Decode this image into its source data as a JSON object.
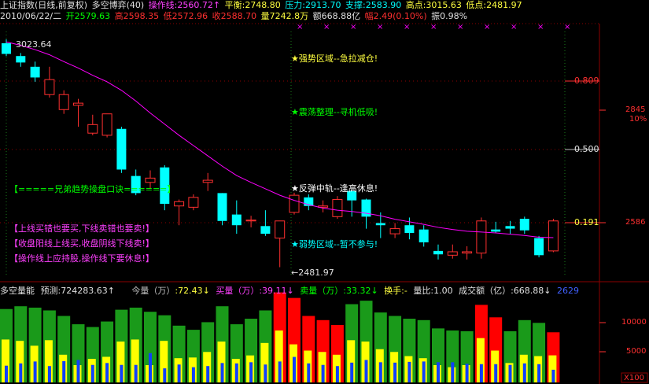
{
  "header": {
    "title": "上证指数(日线,前复权)",
    "indicator": "多空博弈(40)",
    "operation_line": "操作线:2560.72↑",
    "balance": "平衡:2748.80",
    "pressure": "压力:2913.70",
    "support": "支撑:2583.90",
    "high_point": "高点:3015.63",
    "low_point": "低点:2481.97",
    "date": "2010/06/22/二",
    "open": "开2579.63",
    "high": "高2598.35",
    "low": "低2572.96",
    "close": "收2588.70",
    "volume": "量7242.8万",
    "amount": "额668.88亿",
    "change": "幅2.49(0.10%)",
    "amplitude": "振0.98%"
  },
  "price_chart": {
    "peak_label": "3023.64",
    "trough_label": "←2481.97",
    "zones": {
      "strong": "★强势区域--急拉减仓!",
      "shock": "★震荡整理--寻机低吸!",
      "rebound": "★反弹中轨--逢高休息!",
      "weak": "★弱势区域--暂不参与!"
    },
    "tips": [
      "【=====兄弟趋势操盘口诀======】",
      "【上线买错也要买,下线卖错也要卖!】",
      "【收盘阳线上线买,收盘阴线下线卖!】",
      "【操作线上应持股,操作线下要休息!】"
    ],
    "levels": {
      "l0809": "0.809",
      "l0500": "0.500",
      "l0191": "0.191"
    },
    "right_axis": {
      "top": "2845",
      "pct": "10%",
      "bottom": "2586"
    }
  },
  "volume": {
    "title": "多空量能",
    "forecast": "预测:724283.63↑",
    "today_label": "今量（万）",
    "today_value": ":72.43↓",
    "buy_label": "买量（万）",
    "buy_value": ":39.11↓",
    "sell_label": "卖量（万）",
    "sell_value": ":33.32↓",
    "turnover_label": "换手:",
    "turnover_value": "-",
    "ratio": "量比:1.00",
    "amount_label": "成交额（亿）",
    "amount_value": ":668.88↓",
    "extra": "2629",
    "axis": {
      "a10000": "10000",
      "a5000": "5000",
      "unit": "X100"
    }
  },
  "colors": {
    "up": "#ff3030",
    "down": "#00ffff",
    "ma": "#ff00ff",
    "green_vol": "#1a9a1a",
    "yellow_vol": "#ffff00",
    "red_vol": "#ff0000",
    "blue_vol": "#1040ff"
  },
  "chart_data": {
    "type": "candlestick",
    "candles": [
      {
        "o": 3015,
        "c": 2990,
        "h": 3024,
        "l": 2985
      },
      {
        "o": 2985,
        "c": 2970,
        "h": 2992,
        "l": 2960
      },
      {
        "o": 2960,
        "c": 2935,
        "h": 2972,
        "l": 2925
      },
      {
        "o": 2895,
        "c": 2930,
        "h": 2960,
        "l": 2888
      },
      {
        "o": 2860,
        "c": 2895,
        "h": 2905,
        "l": 2850
      },
      {
        "o": 2870,
        "c": 2875,
        "h": 2885,
        "l": 2820
      },
      {
        "o": 2805,
        "c": 2825,
        "h": 2848,
        "l": 2800
      },
      {
        "o": 2800,
        "c": 2850,
        "h": 2850,
        "l": 2795
      },
      {
        "o": 2815,
        "c": 2720,
        "h": 2820,
        "l": 2712
      },
      {
        "o": 2705,
        "c": 2665,
        "h": 2720,
        "l": 2660
      },
      {
        "o": 2690,
        "c": 2700,
        "h": 2718,
        "l": 2675
      },
      {
        "o": 2725,
        "c": 2640,
        "h": 2730,
        "l": 2625
      },
      {
        "o": 2635,
        "c": 2645,
        "h": 2650,
        "l": 2590
      },
      {
        "o": 2632,
        "c": 2655,
        "h": 2662,
        "l": 2625
      },
      {
        "o": 2690,
        "c": 2695,
        "h": 2712,
        "l": 2670
      },
      {
        "o": 2665,
        "c": 2600,
        "h": 2665,
        "l": 2590
      },
      {
        "o": 2615,
        "c": 2590,
        "h": 2648,
        "l": 2570
      },
      {
        "o": 2600,
        "c": 2602,
        "h": 2612,
        "l": 2585
      },
      {
        "o": 2588,
        "c": 2570,
        "h": 2625,
        "l": 2565
      },
      {
        "o": 2560,
        "c": 2600,
        "h": 2600,
        "l": 2492
      },
      {
        "o": 2620,
        "c": 2660,
        "h": 2666,
        "l": 2615
      },
      {
        "o": 2655,
        "c": 2635,
        "h": 2662,
        "l": 2625
      },
      {
        "o": 2632,
        "c": 2635,
        "h": 2648,
        "l": 2620
      },
      {
        "o": 2610,
        "c": 2650,
        "h": 2658,
        "l": 2605
      },
      {
        "o": 2670,
        "c": 2648,
        "h": 2672,
        "l": 2610
      },
      {
        "o": 2650,
        "c": 2610,
        "h": 2652,
        "l": 2582
      },
      {
        "o": 2595,
        "c": 2590,
        "h": 2620,
        "l": 2560
      },
      {
        "o": 2570,
        "c": 2582,
        "h": 2595,
        "l": 2560
      },
      {
        "o": 2590,
        "c": 2572,
        "h": 2608,
        "l": 2557
      },
      {
        "o": 2580,
        "c": 2550,
        "h": 2590,
        "l": 2540
      },
      {
        "o": 2530,
        "c": 2522,
        "h": 2545,
        "l": 2510
      },
      {
        "o": 2520,
        "c": 2528,
        "h": 2545,
        "l": 2512
      },
      {
        "o": 2525,
        "c": 2528,
        "h": 2541,
        "l": 2510
      },
      {
        "o": 2525,
        "c": 2600,
        "h": 2608,
        "l": 2512
      },
      {
        "o": 2580,
        "c": 2575,
        "h": 2598,
        "l": 2572
      },
      {
        "o": 2588,
        "c": 2582,
        "h": 2600,
        "l": 2570
      },
      {
        "o": 2605,
        "c": 2578,
        "h": 2610,
        "l": 2570
      },
      {
        "o": 2560,
        "c": 2520,
        "h": 2565,
        "l": 2515
      },
      {
        "o": 2530,
        "c": 2600,
        "h": 2605,
        "l": 2527
      }
    ],
    "ma": [
      3018,
      3010,
      3000,
      2988,
      2972,
      2957,
      2940,
      2925,
      2905,
      2880,
      2852,
      2826,
      2800,
      2776,
      2752,
      2728,
      2706,
      2690,
      2675,
      2660,
      2648,
      2638,
      2630,
      2625,
      2622,
      2618,
      2612,
      2604,
      2598,
      2592,
      2585,
      2580,
      2576,
      2574,
      2572,
      2569,
      2566,
      2562,
      2561
    ],
    "volume": [
      {
        "v": 10600,
        "buy": 6200,
        "sell": 4400,
        "dir": "down"
      },
      {
        "v": 11000,
        "buy": 6000,
        "sell": 5000,
        "dir": "down"
      },
      {
        "v": 10800,
        "buy": 5300,
        "sell": 5500,
        "dir": "down"
      },
      {
        "v": 10400,
        "buy": 6100,
        "sell": 4300,
        "dir": "down"
      },
      {
        "v": 9600,
        "buy": 4000,
        "sell": 5600,
        "dir": "down"
      },
      {
        "v": 8400,
        "buy": 2500,
        "sell": 5900,
        "dir": "down"
      },
      {
        "v": 8000,
        "buy": 3400,
        "sell": 4600,
        "dir": "down"
      },
      {
        "v": 8800,
        "buy": 3700,
        "sell": 5100,
        "dir": "down"
      },
      {
        "v": 10500,
        "buy": 5900,
        "sell": 4600,
        "dir": "down"
      },
      {
        "v": 10800,
        "buy": 6200,
        "sell": 4600,
        "dir": "down"
      },
      {
        "v": 10200,
        "buy": 2500,
        "sell": 7700,
        "dir": "down"
      },
      {
        "v": 9700,
        "buy": 6000,
        "sell": 3700,
        "dir": "down"
      },
      {
        "v": 8200,
        "buy": 3500,
        "sell": 4700,
        "dir": "down"
      },
      {
        "v": 7600,
        "buy": 3600,
        "sell": 4000,
        "dir": "down"
      },
      {
        "v": 8700,
        "buy": 4400,
        "sell": 4300,
        "dir": "down"
      },
      {
        "v": 11000,
        "buy": 5900,
        "sell": 5100,
        "dir": "down"
      },
      {
        "v": 8400,
        "buy": 3400,
        "sell": 5000,
        "dir": "down"
      },
      {
        "v": 9200,
        "buy": 3900,
        "sell": 5300,
        "dir": "down"
      },
      {
        "v": 10400,
        "buy": 5700,
        "sell": 4700,
        "dir": "down"
      },
      {
        "v": 13000,
        "buy": 7500,
        "sell": 5500,
        "dir": "up"
      },
      {
        "v": 12200,
        "buy": 5500,
        "sell": 6700,
        "dir": "up"
      },
      {
        "v": 9600,
        "buy": 4600,
        "sell": 5000,
        "dir": "up"
      },
      {
        "v": 9000,
        "buy": 4400,
        "sell": 4600,
        "dir": "up"
      },
      {
        "v": 8300,
        "buy": 4000,
        "sell": 4300,
        "dir": "up"
      },
      {
        "v": 11300,
        "buy": 6100,
        "sell": 5200,
        "dir": "down"
      },
      {
        "v": 11800,
        "buy": 5900,
        "sell": 5900,
        "dir": "down"
      },
      {
        "v": 10100,
        "buy": 4800,
        "sell": 5300,
        "dir": "down"
      },
      {
        "v": 9600,
        "buy": 4400,
        "sell": 5200,
        "dir": "down"
      },
      {
        "v": 9200,
        "buy": 3800,
        "sell": 5400,
        "dir": "down"
      },
      {
        "v": 9000,
        "buy": 3500,
        "sell": 5500,
        "dir": "down"
      },
      {
        "v": 7800,
        "buy": 2500,
        "sell": 5300,
        "dir": "down"
      },
      {
        "v": 7500,
        "buy": 2200,
        "sell": 5300,
        "dir": "down"
      },
      {
        "v": 7400,
        "buy": 2500,
        "sell": 4900,
        "dir": "down"
      },
      {
        "v": 11200,
        "buy": 6400,
        "sell": 4800,
        "dir": "up"
      },
      {
        "v": 9400,
        "buy": 4600,
        "sell": 4800,
        "dir": "up"
      },
      {
        "v": 7400,
        "buy": 2800,
        "sell": 4600,
        "dir": "down"
      },
      {
        "v": 9000,
        "buy": 4000,
        "sell": 5000,
        "dir": "down"
      },
      {
        "v": 8600,
        "buy": 3800,
        "sell": 4800,
        "dir": "down"
      },
      {
        "v": 7242,
        "buy": 3911,
        "sell": 3332,
        "dir": "up"
      }
    ]
  }
}
